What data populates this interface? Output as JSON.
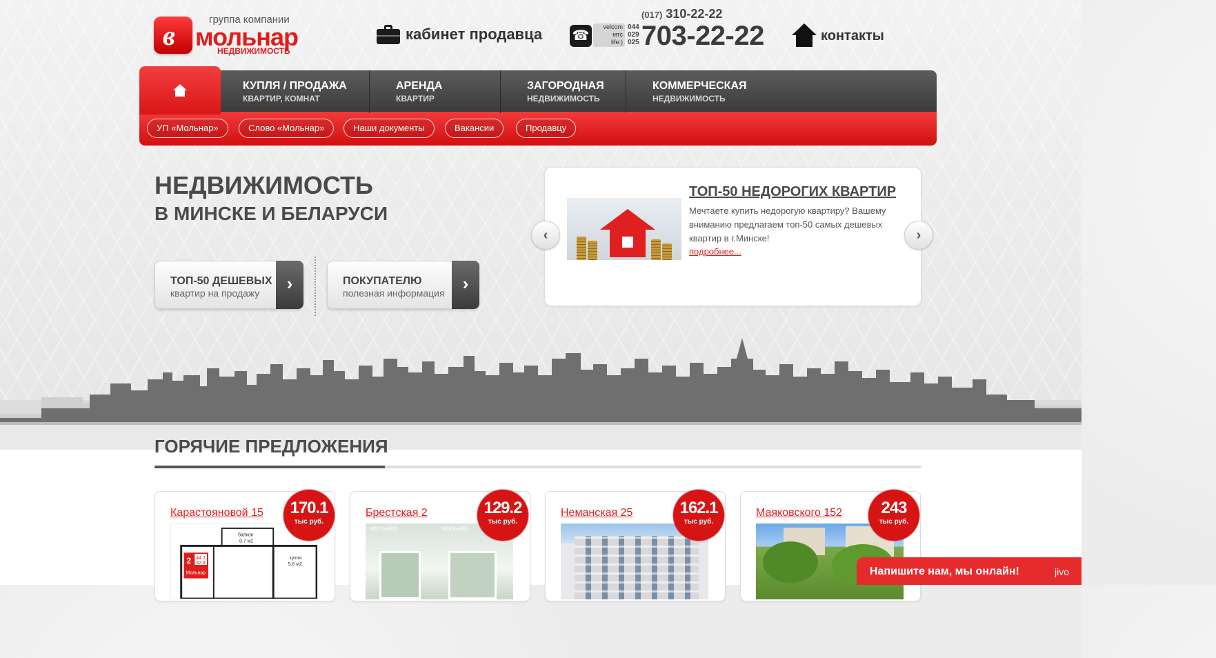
{
  "header": {
    "logo": {
      "top": "группа компании",
      "main": "мольнар",
      "sub": "НЕДВИЖИМОСТЬ",
      "badge": "в"
    },
    "cabinet_label": "кабинет продавца",
    "phone_small_code": "(017)",
    "phone_small": "310-22-22",
    "operators": [
      "velcom",
      "мтс",
      "life:)"
    ],
    "operator_codes": [
      "044",
      "029",
      "025"
    ],
    "phone_big": "703-22-22",
    "contacts_label": "контакты"
  },
  "nav": {
    "items": [
      {
        "t1": "КУПЛЯ / ПРОДАЖА",
        "t2": "КВАРТИР, КОМНАТ"
      },
      {
        "t1": "АРЕНДА",
        "t2": "КВАРТИР"
      },
      {
        "t1": "ЗАГОРОДНАЯ",
        "t2": "НЕДВИЖИМОСТЬ"
      },
      {
        "t1": "КОММЕРЧЕСКАЯ",
        "t2": "НЕДВИЖИМОСТЬ"
      }
    ],
    "sub_items": [
      "УП «Мольнар»",
      "Слово «Мольнар»",
      "Наши документы",
      "Вакансии",
      "Продавцу"
    ]
  },
  "hero": {
    "title1": "НЕДВИЖИМОСТЬ",
    "title2": "В МИНСКЕ И БЕЛАРУСИ",
    "cta": [
      {
        "c1": "ТОП-50 ДЕШЕВЫХ",
        "c2": "квартир на продажу"
      },
      {
        "c1": "ПОКУПАТЕЛЮ",
        "c2": "полезная информация"
      }
    ]
  },
  "slider": {
    "title": "ТОП-50 НЕДОРОГИХ КВАРТИР",
    "text": "Мечтаете купить недорогую квартиру? Вашему вниманию предлагаем топ-50 самых дешевых квартир в г.Минске!",
    "more": "подробнее..."
  },
  "hot": {
    "title": "ГОРЯЧИЕ ПРЕДЛОЖЕНИЯ",
    "price_unit": "тыс руб.",
    "cards": [
      {
        "title": "Карастояновой 15",
        "price": "170.1"
      },
      {
        "title": "Брестская 2",
        "price": "129.2"
      },
      {
        "title": "Неманская 25",
        "price": "162.1"
      },
      {
        "title": "Маяковского 152",
        "price": "243"
      }
    ],
    "plan": {
      "room_count": "2",
      "area_total": "44.2",
      "area_living": "32.6",
      "brand": "Мольнар",
      "balcony": "балкон",
      "balcony_area": "0.7 м2",
      "kitchen": "кухня",
      "kitchen_area": "5.6 м2"
    },
    "watermark": "мольнар"
  },
  "chat": {
    "label": "Напишите нам, мы онлайн!",
    "logo": "jivo"
  }
}
